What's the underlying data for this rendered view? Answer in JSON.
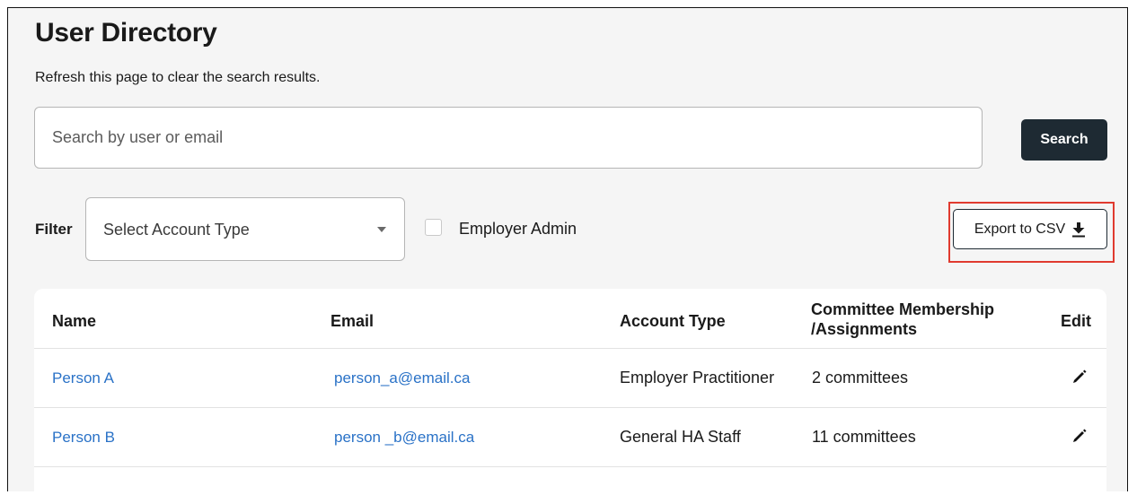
{
  "page": {
    "title": "User Directory",
    "subtitle": "Refresh this page to clear the search results."
  },
  "search": {
    "placeholder": "Search by user or email",
    "value": "",
    "button_label": "Search"
  },
  "filter": {
    "label": "Filter",
    "account_type_placeholder": "Select Account Type",
    "employer_admin_label": "Employer Admin",
    "employer_admin_checked": false
  },
  "export": {
    "label": "Export to CSV",
    "icon": "download-icon",
    "highlight_color": "#e03a2f"
  },
  "table": {
    "headers": {
      "name": "Name",
      "email": "Email",
      "account_type": "Account Type",
      "committee_line1": "Committee Membership",
      "committee_line2": "/Assignments",
      "edit": "Edit"
    },
    "rows": [
      {
        "name": "Person A",
        "email": "person_a@email.ca",
        "account_type": "Employer Practitioner",
        "committees": "2 committees",
        "edit_icon": "pencil-icon"
      },
      {
        "name": "Person B",
        "email": "person _b@email.ca",
        "account_type": "General HA Staff",
        "committees": "11 committees",
        "edit_icon": "pencil-icon"
      }
    ]
  },
  "colors": {
    "link": "#2a72c7",
    "primary_button": "#1e2a33",
    "background": "#f5f5f5"
  }
}
